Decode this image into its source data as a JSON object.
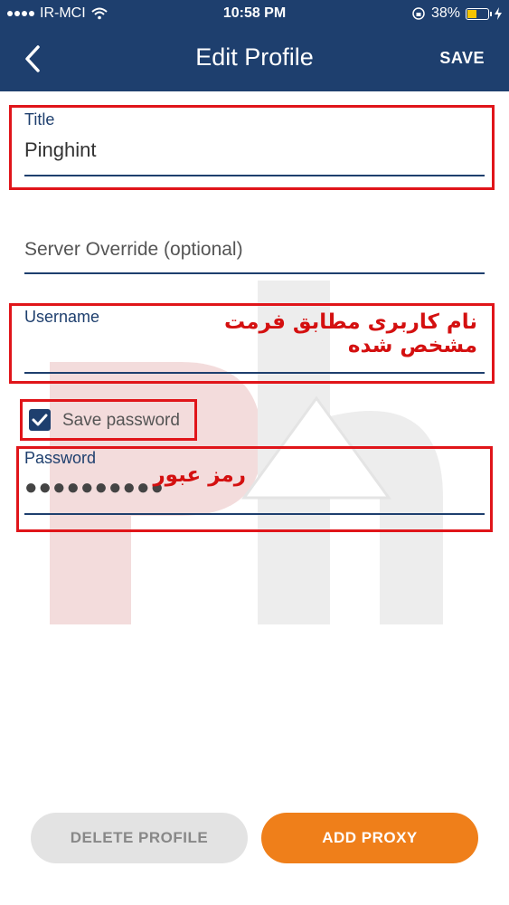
{
  "status_bar": {
    "carrier": "IR-MCI",
    "time": "10:58 PM",
    "battery": "38%"
  },
  "header": {
    "title": "Edit Profile",
    "save_label": "SAVE"
  },
  "form": {
    "title_label": "Title",
    "title_value": "Pinghint",
    "server_placeholder": "Server Override (optional)",
    "username_label": "Username",
    "save_password_label": "Save password",
    "save_password_checked": true,
    "password_label": "Password",
    "password_mask": "●●●●●●●●●●"
  },
  "annotations": {
    "username_note": "نام کاربری مطابق فرمت مشخص شده",
    "password_note": "رمز عبور"
  },
  "buttons": {
    "delete_label": "DELETE PROFILE",
    "add_label": "ADD PROXY"
  },
  "colors": {
    "header_bg": "#1e3f6e",
    "accent_orange": "#ef7f1a",
    "annotation_red": "#e0151a"
  }
}
